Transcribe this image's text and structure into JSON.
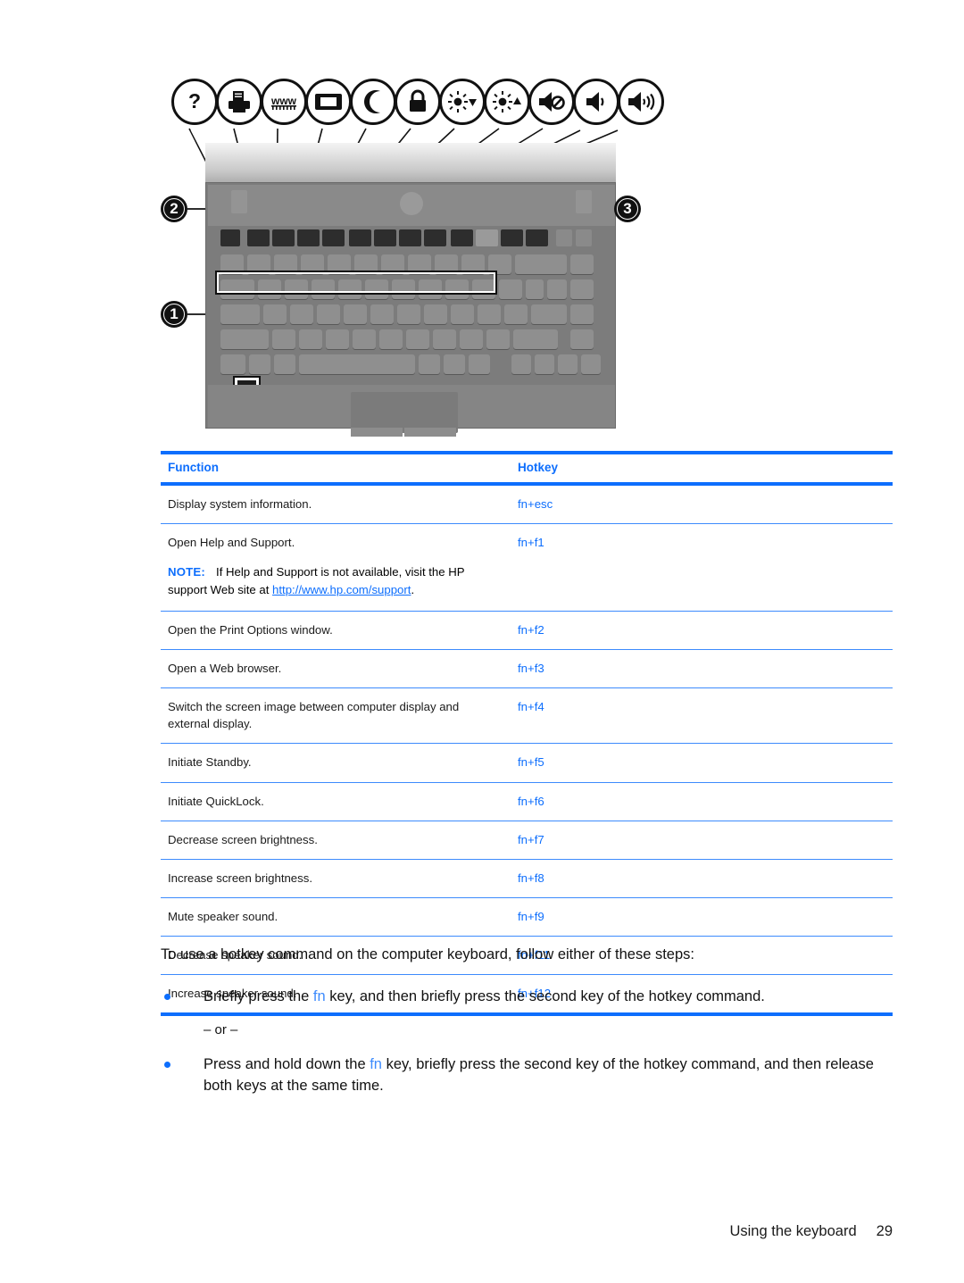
{
  "figure": {
    "alt": "HP notebook computer keyboard with hotkey callouts",
    "callouts": [
      {
        "number": "1",
        "target": "fn-key"
      },
      {
        "number": "2",
        "target": "function-key-row-left"
      },
      {
        "number": "3",
        "target": "function-key-row-right"
      }
    ],
    "hotkey_icons": [
      {
        "name": "question-mark-icon",
        "meaning": "Help and Support"
      },
      {
        "name": "printer-icon",
        "meaning": "Print Options"
      },
      {
        "name": "www-icon",
        "meaning": "Web browser"
      },
      {
        "name": "display-switch-icon",
        "meaning": "Switch screen image"
      },
      {
        "name": "moon-icon",
        "meaning": "Standby"
      },
      {
        "name": "lock-icon",
        "meaning": "QuickLock"
      },
      {
        "name": "brightness-decrease-icon",
        "meaning": "Decrease screen brightness"
      },
      {
        "name": "brightness-increase-icon",
        "meaning": "Increase screen brightness"
      },
      {
        "name": "speaker-mute-icon",
        "meaning": "Mute speaker sound"
      },
      {
        "name": "speaker-decrease-icon",
        "meaning": "Decrease speaker sound"
      },
      {
        "name": "speaker-increase-icon",
        "meaning": "Increase speaker sound"
      }
    ]
  },
  "table": {
    "headers": {
      "function": "Function",
      "hotkey": "Hotkey"
    },
    "accent_color": "#0d6efd",
    "rows": [
      {
        "function": "Display system information.",
        "hotkey": "fn+esc"
      },
      {
        "function": "Open Help and Support.",
        "hotkey": "fn+f1",
        "note": {
          "label": "NOTE:",
          "text_before_url": "If Help and Support is not available, visit the HP support Web site at ",
          "url": "http://www.hp.com/support",
          "text_after_url": "."
        }
      },
      {
        "function": "Open the Print Options window.",
        "hotkey": "fn+f2"
      },
      {
        "function": "Open a Web browser.",
        "hotkey": "fn+f3"
      },
      {
        "function": "Switch the screen image between computer display and external display.",
        "hotkey": "fn+f4"
      },
      {
        "function": "Initiate Standby.",
        "hotkey": "fn+f5"
      },
      {
        "function": "Initiate QuickLock.",
        "hotkey": "fn+f6"
      },
      {
        "function": "Decrease screen brightness.",
        "hotkey": "fn+f7"
      },
      {
        "function": "Increase screen brightness.",
        "hotkey": "fn+f8"
      },
      {
        "function": "Mute speaker sound.",
        "hotkey": "fn+f9"
      },
      {
        "function": "Decrease speaker sound.",
        "hotkey": "fn+f11"
      },
      {
        "function": "Increase speaker sound.",
        "hotkey": "fn+f12"
      }
    ]
  },
  "body": {
    "lead": "To use a hotkey command on the computer keyboard, follow either of these steps:",
    "bullet1_before": "Briefly press the ",
    "bullet1_fn": "fn",
    "bullet1_after": " key, and then briefly press the second key of the hotkey command.",
    "or_text": "– or –",
    "bullet2_before": "Press and hold down the ",
    "bullet2_fn": "fn",
    "bullet2_after": " key, briefly press the second key of the hotkey command, and then release both keys at the same time."
  },
  "footer": {
    "section": "Using the keyboard",
    "page_number": "29"
  }
}
